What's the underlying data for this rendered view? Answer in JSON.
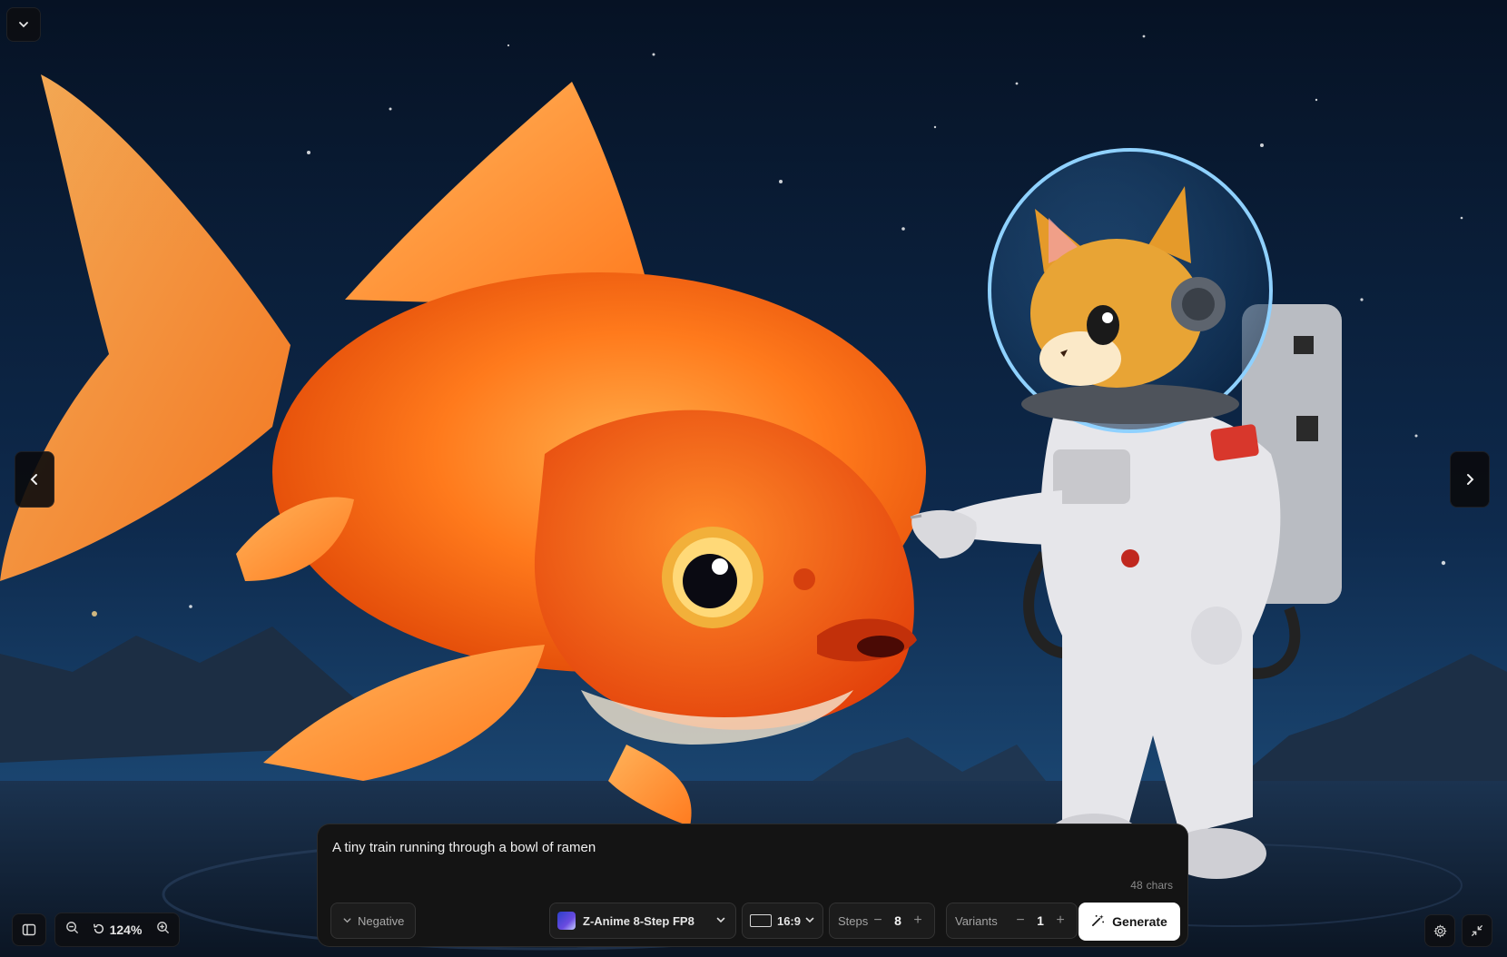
{
  "image": {
    "alt_icons": [
      "chevron-left-icon",
      "chevron-right-icon"
    ]
  },
  "zoom": {
    "level": "124%"
  },
  "prompt": {
    "value": "A tiny train running through a bowl of ramen",
    "char_count": "48",
    "char_unit": "chars"
  },
  "controls": {
    "negative_label": "Negative",
    "model_label": "Z-Anime 8-Step FP8",
    "ratio_label": "16:9",
    "steps_label": "Steps",
    "steps_value": "8",
    "variants_label": "Variants",
    "variants_value": "1",
    "generate_label": "Generate"
  },
  "colors": {
    "sky_top": "#071326",
    "sky_bottom": "#12355f",
    "goldfish": "#ff6a12",
    "accent_button": "#ffffff"
  }
}
